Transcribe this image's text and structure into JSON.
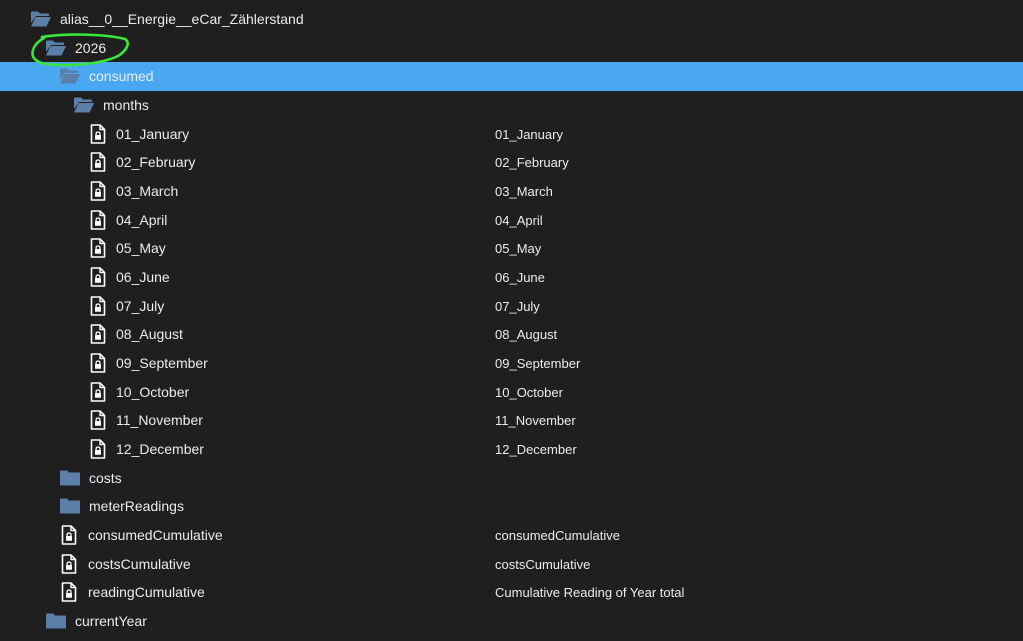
{
  "tree": {
    "root": {
      "label": "alias__0__Energie__eCar_Zählerstand"
    },
    "year": {
      "label": "2026"
    },
    "consumed": {
      "label": "consumed"
    },
    "months": {
      "label": "months",
      "items": [
        {
          "label": "01_January",
          "description": "01_January"
        },
        {
          "label": "02_February",
          "description": "02_February"
        },
        {
          "label": "03_March",
          "description": "03_March"
        },
        {
          "label": "04_April",
          "description": "04_April"
        },
        {
          "label": "05_May",
          "description": "05_May"
        },
        {
          "label": "06_June",
          "description": "06_June"
        },
        {
          "label": "07_July",
          "description": "07_July"
        },
        {
          "label": "08_August",
          "description": "08_August"
        },
        {
          "label": "09_September",
          "description": "09_September"
        },
        {
          "label": "10_October",
          "description": "10_October"
        },
        {
          "label": "11_November",
          "description": "11_November"
        },
        {
          "label": "12_December",
          "description": "12_December"
        }
      ]
    },
    "costs": {
      "label": "costs"
    },
    "meter_readings": {
      "label": "meterReadings"
    },
    "consumed_cumulative": {
      "label": "consumedCumulative",
      "description": "consumedCumulative"
    },
    "costs_cumulative": {
      "label": "costsCumulative",
      "description": "costsCumulative"
    },
    "reading_cumulative": {
      "label": "readingCumulative",
      "description": "Cumulative Reading of Year total"
    },
    "current_year": {
      "label": "currentYear"
    }
  },
  "colors": {
    "background": "#1f1f1f",
    "selection": "#4aa8f2",
    "folder": "#5b7fa8",
    "text": "#ececec",
    "annotation": "#39e639"
  },
  "icons": {
    "folder_open": "folder-open-icon",
    "folder_closed": "folder-icon",
    "file_locked": "locked-file-icon"
  }
}
